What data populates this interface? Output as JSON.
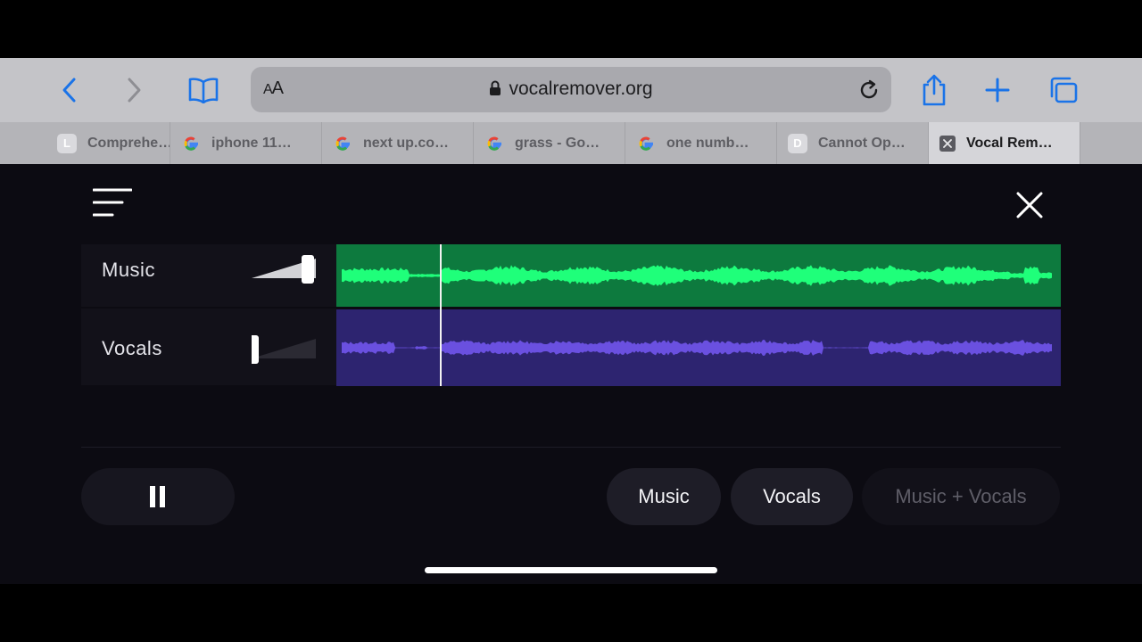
{
  "browser": {
    "text_size_label": "AA",
    "url": "vocalremover.org",
    "accent": "#1a73e8"
  },
  "tabs": [
    {
      "favicon": "L",
      "label": "Comprehe…",
      "icon": "letter-favicon"
    },
    {
      "favicon": "",
      "label": "iphone 11…",
      "icon": "google-icon"
    },
    {
      "favicon": "",
      "label": "next up.co…",
      "icon": "google-icon"
    },
    {
      "favicon": "",
      "label": "grass - Go…",
      "icon": "google-icon"
    },
    {
      "favicon": "",
      "label": "one numb…",
      "icon": "google-icon"
    },
    {
      "favicon": "D",
      "label": "Cannot Op…",
      "icon": "letter-favicon"
    },
    {
      "favicon": "",
      "label": "Vocal Rem…",
      "icon": "close-tab-icon",
      "active": true
    }
  ],
  "tracks": {
    "music": {
      "label": "Music",
      "volume": 1.0,
      "color": "#1fff7a"
    },
    "vocals": {
      "label": "Vocals",
      "volume": 0.0,
      "color": "#6a50e0"
    }
  },
  "player": {
    "state": "playing",
    "playhead_fraction": 0.143
  },
  "modes": {
    "music": "Music",
    "vocals": "Vocals",
    "both": "Music + Vocals"
  }
}
